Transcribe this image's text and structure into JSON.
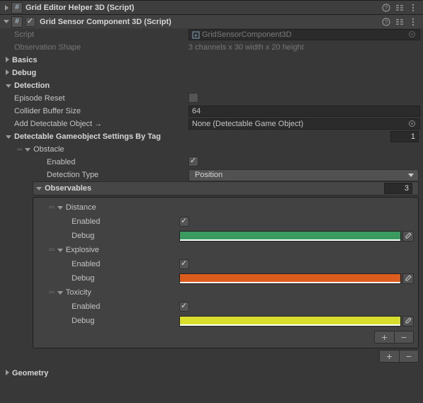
{
  "header1": {
    "title": "Grid Editor Helper 3D (Script)"
  },
  "header2": {
    "title": "Grid Sensor Component 3D (Script)"
  },
  "script": {
    "label": "Script",
    "value": "GridSensorComponent3D"
  },
  "obs_shape": {
    "label": "Observation Shape",
    "value": "3 channels x 30 width x 20 height"
  },
  "basics": {
    "label": "Basics"
  },
  "debug": {
    "label": "Debug"
  },
  "detection": {
    "label": "Detection"
  },
  "episode_reset": {
    "label": "Episode Reset"
  },
  "collider_buffer": {
    "label": "Collider Buffer Size",
    "value": "64"
  },
  "add_detectable": {
    "label": "Add Detectable Object →",
    "value": "None (Detectable Game Object)"
  },
  "det_settings": {
    "label": "Detectable Gameobject Settings By Tag",
    "count": "1"
  },
  "obstacle": {
    "label": "Obstacle",
    "enabled_label": "Enabled",
    "type_label": "Detection Type",
    "type_value": "Position"
  },
  "observables": {
    "label": "Observables",
    "count": "3"
  },
  "distance": {
    "label": "Distance",
    "enabled_label": "Enabled",
    "debug_label": "Debug"
  },
  "explosive": {
    "label": "Explosive",
    "enabled_label": "Enabled",
    "debug_label": "Debug"
  },
  "toxicity": {
    "label": "Toxicity",
    "enabled_label": "Enabled",
    "debug_label": "Debug"
  },
  "geometry": {
    "label": "Geometry"
  },
  "glyph": {
    "plus": "+",
    "minus": "−"
  }
}
